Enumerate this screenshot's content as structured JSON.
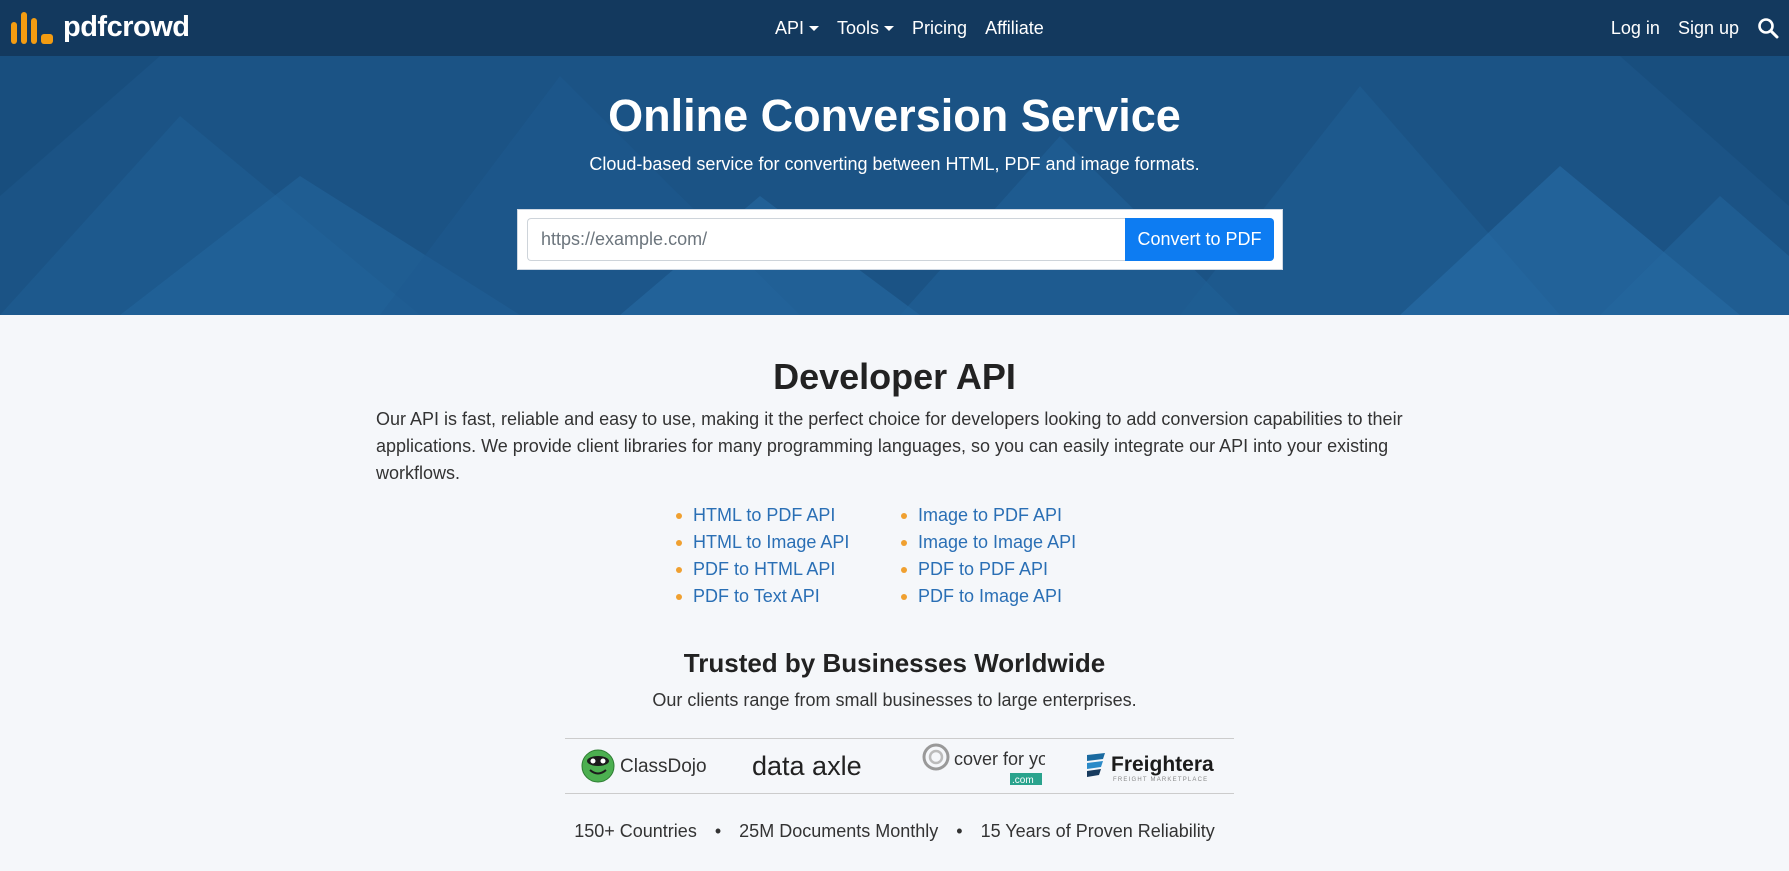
{
  "nav": {
    "logo_text": "pdfcrowd",
    "links": [
      {
        "label": "API",
        "dropdown": true
      },
      {
        "label": "Tools",
        "dropdown": true
      },
      {
        "label": "Pricing",
        "dropdown": false
      },
      {
        "label": "Affiliate",
        "dropdown": false
      }
    ],
    "login": "Log in",
    "signup": "Sign up",
    "search_icon": "search-icon"
  },
  "hero": {
    "title": "Online Conversion Service",
    "subtitle": "Cloud-based service for converting between HTML, PDF and image formats.",
    "url_placeholder": "https://example.com/",
    "url_value": "",
    "convert_label": "Convert to PDF"
  },
  "developer": {
    "title": "Developer API",
    "description": "Our API is fast, reliable and easy to use, making it the perfect choice for developers looking to add conversion capabilities to their applications. We provide client libraries for many programming languages, so you can easily integrate our API into your existing workflows.",
    "apis_left": [
      "HTML to PDF API",
      "HTML to Image API",
      "PDF to HTML API",
      "PDF to Text API"
    ],
    "apis_right": [
      "Image to PDF API",
      "Image to Image API",
      "PDF to PDF API",
      "PDF to Image API"
    ]
  },
  "trust": {
    "title": "Trusted by Businesses Worldwide",
    "subtitle": "Our clients range from small businesses to large enterprises.",
    "clients": [
      {
        "name": "ClassDojo"
      },
      {
        "name": "data axle"
      },
      {
        "name": "cover for you",
        "suffix": ".com"
      },
      {
        "name": "Freightera",
        "tagline": "FREIGHT MARKETPLACE"
      }
    ],
    "stats": [
      "150+ Countries",
      "25M Documents Monthly",
      "15 Years of Proven Reliability"
    ],
    "stats_separator": "•"
  },
  "colors": {
    "navbar": "#13395e",
    "hero": "#1b5385",
    "accent_button": "#0d7cf2",
    "link": "#2a6fb5",
    "bullet": "#f0a030",
    "logo_orange": "#f39c12"
  }
}
